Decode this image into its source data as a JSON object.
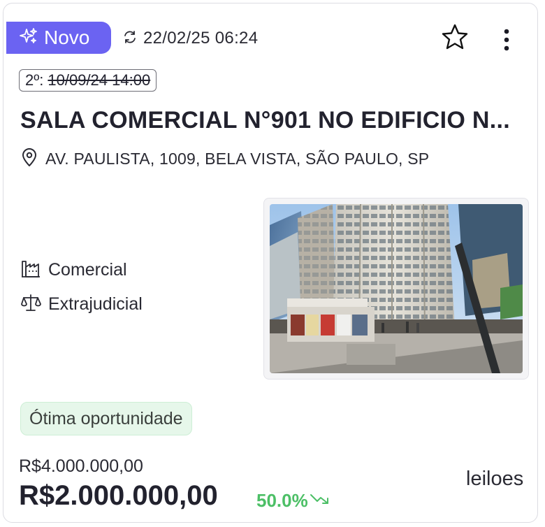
{
  "badge": {
    "label": "Novo",
    "icon": "sparkles-icon",
    "color": "#6b63f2"
  },
  "updated": {
    "icon": "refresh-icon",
    "datetime": "22/02/25 06:24"
  },
  "actions": {
    "favorite_icon": "star-icon",
    "menu_icon": "kebab-menu-icon"
  },
  "second_auction": {
    "label": "2º:",
    "datetime": "10/09/24 14:00"
  },
  "title": "SALA COMERCIAL N°901 NO EDIFICIO N...",
  "address": {
    "icon": "map-pin-icon",
    "text": "AV. PAULISTA, 1009, BELA VISTA, SÃO PAULO, SP"
  },
  "attributes": [
    {
      "icon": "factory-icon",
      "label": "Comercial"
    },
    {
      "icon": "scale-icon",
      "label": "Extrajudicial"
    }
  ],
  "tag": {
    "label": "Ótima oportunidade",
    "color": "#e6f7ea"
  },
  "pricing": {
    "original": "R$4.000.000,00",
    "current": "R$2.000.000,00",
    "discount": "50.0%",
    "discount_icon": "trend-down-icon",
    "discount_color": "#4cbf66"
  },
  "source": "leiloes"
}
